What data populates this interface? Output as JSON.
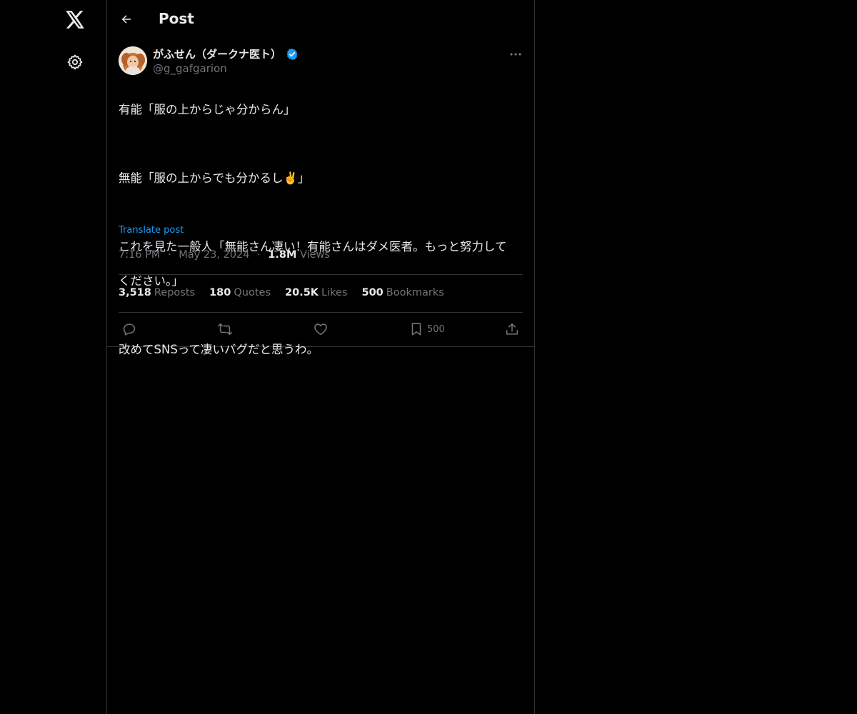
{
  "header": {
    "title": "Post"
  },
  "post": {
    "author_name": "がふせん（ダークナ医ト）",
    "handle": "@g_gafgarion",
    "text_lines": [
      "有能「服の上からじゃ分からん」",
      "",
      "無能「服の上からでも分かるし✌️」",
      "",
      "これを見た一般人「無能さん凄い！有能さんはダメ医者。もっと努力して",
      "ください。」",
      "",
      "改めてSNSって凄いバグだと思うわ。"
    ],
    "translate_label": "Translate post",
    "time": "7:16 PM",
    "date": "May 23, 2024",
    "views_count": "1.8M",
    "views_label": "Views",
    "separator": "·"
  },
  "stats": [
    {
      "num": "3,518",
      "label": "Reposts"
    },
    {
      "num": "180",
      "label": "Quotes"
    },
    {
      "num": "20.5K",
      "label": "Likes"
    },
    {
      "num": "500",
      "label": "Bookmarks"
    }
  ],
  "actions": {
    "bookmark_count": "500"
  },
  "icons": {
    "logo": "x-logo-icon",
    "settings": "gear-icon",
    "back": "back-arrow-icon",
    "more": "more-dots-icon",
    "verified": "verified-badge-icon",
    "reply": "reply-icon",
    "repost": "repost-icon",
    "like": "heart-icon",
    "bookmark": "bookmark-icon",
    "share": "share-icon"
  },
  "colors": {
    "background": "#000000",
    "text": "#e7e9ea",
    "muted": "#71767b",
    "accent": "#1d9bf0",
    "border": "#2f3336"
  }
}
